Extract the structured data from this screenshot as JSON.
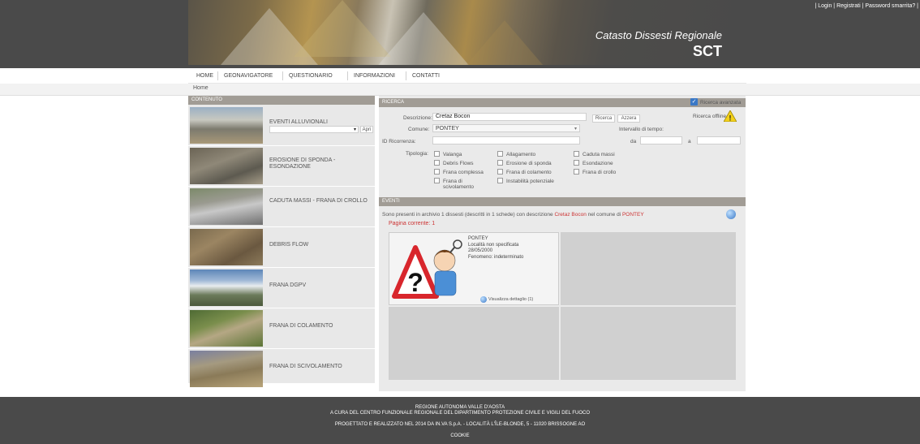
{
  "header": {
    "site_title": "Catasto Dissesti Regionale",
    "site_subtitle": "SCT",
    "top_links": [
      "Login",
      "Registrati",
      "Password smarrita?"
    ]
  },
  "nav": {
    "items": [
      "HOME",
      "GEONAVIGATORE",
      "QUESTIONARIO",
      "INFORMAZIONI",
      "CONTATTI"
    ]
  },
  "breadcrumb": "Home",
  "left": {
    "header": "CONTENUTO",
    "categories": [
      {
        "label": "EVENTI ALLUVIONALI",
        "select_value": "",
        "button": "Apri"
      },
      {
        "label": "EROSIONE DI SPONDA - ESONDAZIONE"
      },
      {
        "label": "CADUTA MASSI - FRANA DI CROLLO"
      },
      {
        "label": "DEBRIS FLOW"
      },
      {
        "label": "FRANA DGPV"
      },
      {
        "label": "FRANA DI COLAMENTO"
      },
      {
        "label": "FRANA DI SCIVOLAMENTO"
      }
    ]
  },
  "search": {
    "header": "RICERCA",
    "advanced_label": "Ricerca avanzata",
    "advanced_checked": true,
    "description_label": "Descrizione:",
    "description_value": "Cretaz Bocon",
    "search_button": "Ricerca",
    "reset_button": "Azzera",
    "offline_label": "Ricerca offline",
    "comune_label": "Comune:",
    "comune_value": "PONTEY",
    "id_label": "ID Ricorrenza:",
    "id_value": "",
    "time_label": "Intervallo di tempo:",
    "from_label": "da",
    "to_label": "a",
    "from_value": "",
    "to_value": "",
    "types_label": "Tipologia:",
    "types": [
      "Valanga",
      "Allagamento",
      "Caduta massi",
      "Debris Flows",
      "Erosione di sponda",
      "Esondazione",
      "Frana complessa",
      "Frana di colamento",
      "Frana di crollo",
      "Frana di scivolamento",
      "Instabilità potenziale"
    ]
  },
  "events": {
    "header": "EVENTI",
    "summary_prefix": "Sono presenti in archivio 1 dissesti (descritti in 1 schede) con descrizione",
    "summary_desc": "Cretaz Bocon",
    "summary_mid": "nel comune di",
    "summary_comune": "PONTEY",
    "page_label": "Pagina corrente: 1",
    "card": {
      "comune": "PONTEY",
      "localita": "Località non specificata",
      "date": "28/05/2000",
      "phenomenon": "Fenomeno: indeterminato",
      "link": "Visualizza dettaglio (1)"
    }
  },
  "footer": {
    "line1": "REGIONE AUTONOMA VALLE D'AOSTA",
    "line2": "A CURA DEL CENTRO FUNZIONALE REGIONALE DEL DIPARTIMENTO PROTEZIONE CIVILE E VIGILI DEL FUOCO",
    "line3": "PROGETTATO E REALIZZATO NEL 2014 DA IN.VA S.p.A. - LOCALITÀ L'ÎLE-BLONDE, 5 - 11020 BRISSOGNE AO",
    "line4": "COOKIE"
  },
  "colors": {
    "header_bg": "#4a4a4a",
    "panel_header": "#a19c95",
    "panel_bg": "#eaeaea",
    "accent_red": "#cc3333"
  }
}
